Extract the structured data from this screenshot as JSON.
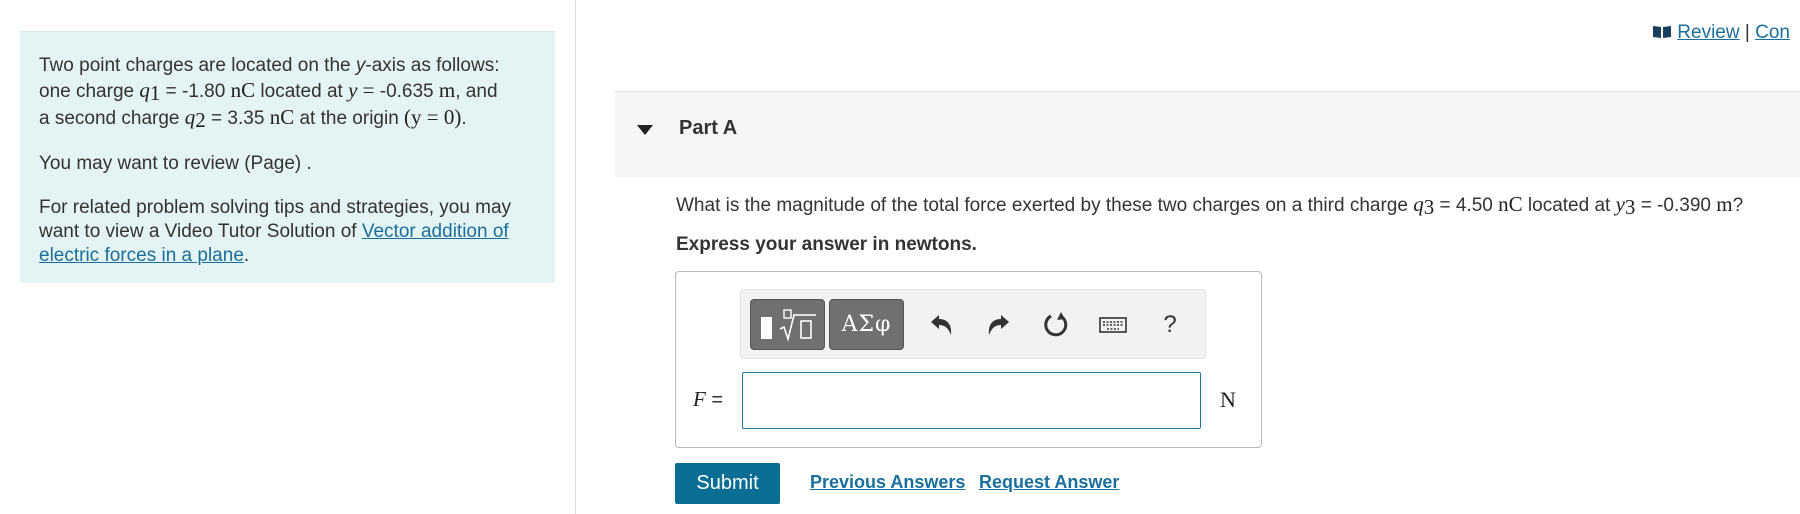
{
  "problem": {
    "intro_a": "Two point charges are located on the ",
    "y_var": "y",
    "intro_b": "-axis as follows:",
    "line2_a": "one charge ",
    "q1_sym": "q",
    "q1_sub": "1",
    "q1_value": " = -1.80 ",
    "q1_unit": "nC",
    "line2_b": " located at ",
    "y_sym": "y",
    "eq": " = ",
    "y1_value": "-0.635 ",
    "y1_unit": "m",
    "line2_c": ", and",
    "line3_a": "a second charge ",
    "q2_sym": "q",
    "q2_sub": "2",
    "q2_value": " = 3.35 ",
    "q2_unit": "nC",
    "line3_b": " at the origin ",
    "origin_expr": "(y = 0)",
    "line3_c": ".",
    "review_text": "You may want to review (Page) .",
    "related_text": "For related problem solving tips and strategies, you may want to view a Video Tutor Solution of ",
    "related_link": "Vector addition of electric forces in a plane",
    "related_end": "."
  },
  "top_links": {
    "review": "Review",
    "separator": " | ",
    "constants": "Con"
  },
  "part": {
    "title": "Part A",
    "question_a": "What is the magnitude of the total force exerted by these two charges on a third charge ",
    "q3_sym": "q",
    "q3_sub": "3",
    "q3_value": " = 4.50 ",
    "q3_unit": "nC",
    "question_b": " located at ",
    "y3_sym": "y",
    "y3_sub": "3",
    "y3_value": " = -0.390 ",
    "y3_unit": "m",
    "question_c": "?",
    "instruction": "Express your answer in newtons."
  },
  "answer": {
    "var_label": "F",
    "equals": " =",
    "value": "",
    "unit": "N"
  },
  "toolbar": {
    "greek_label": "ΑΣφ",
    "help_label": "?"
  },
  "actions": {
    "submit": "Submit",
    "previous_answers": "Previous Answers",
    "request_answer": "Request Answer"
  },
  "colors": {
    "accent": "#0a6e94",
    "link": "#1a6f9c",
    "panel_bg": "#e4f3f3"
  }
}
